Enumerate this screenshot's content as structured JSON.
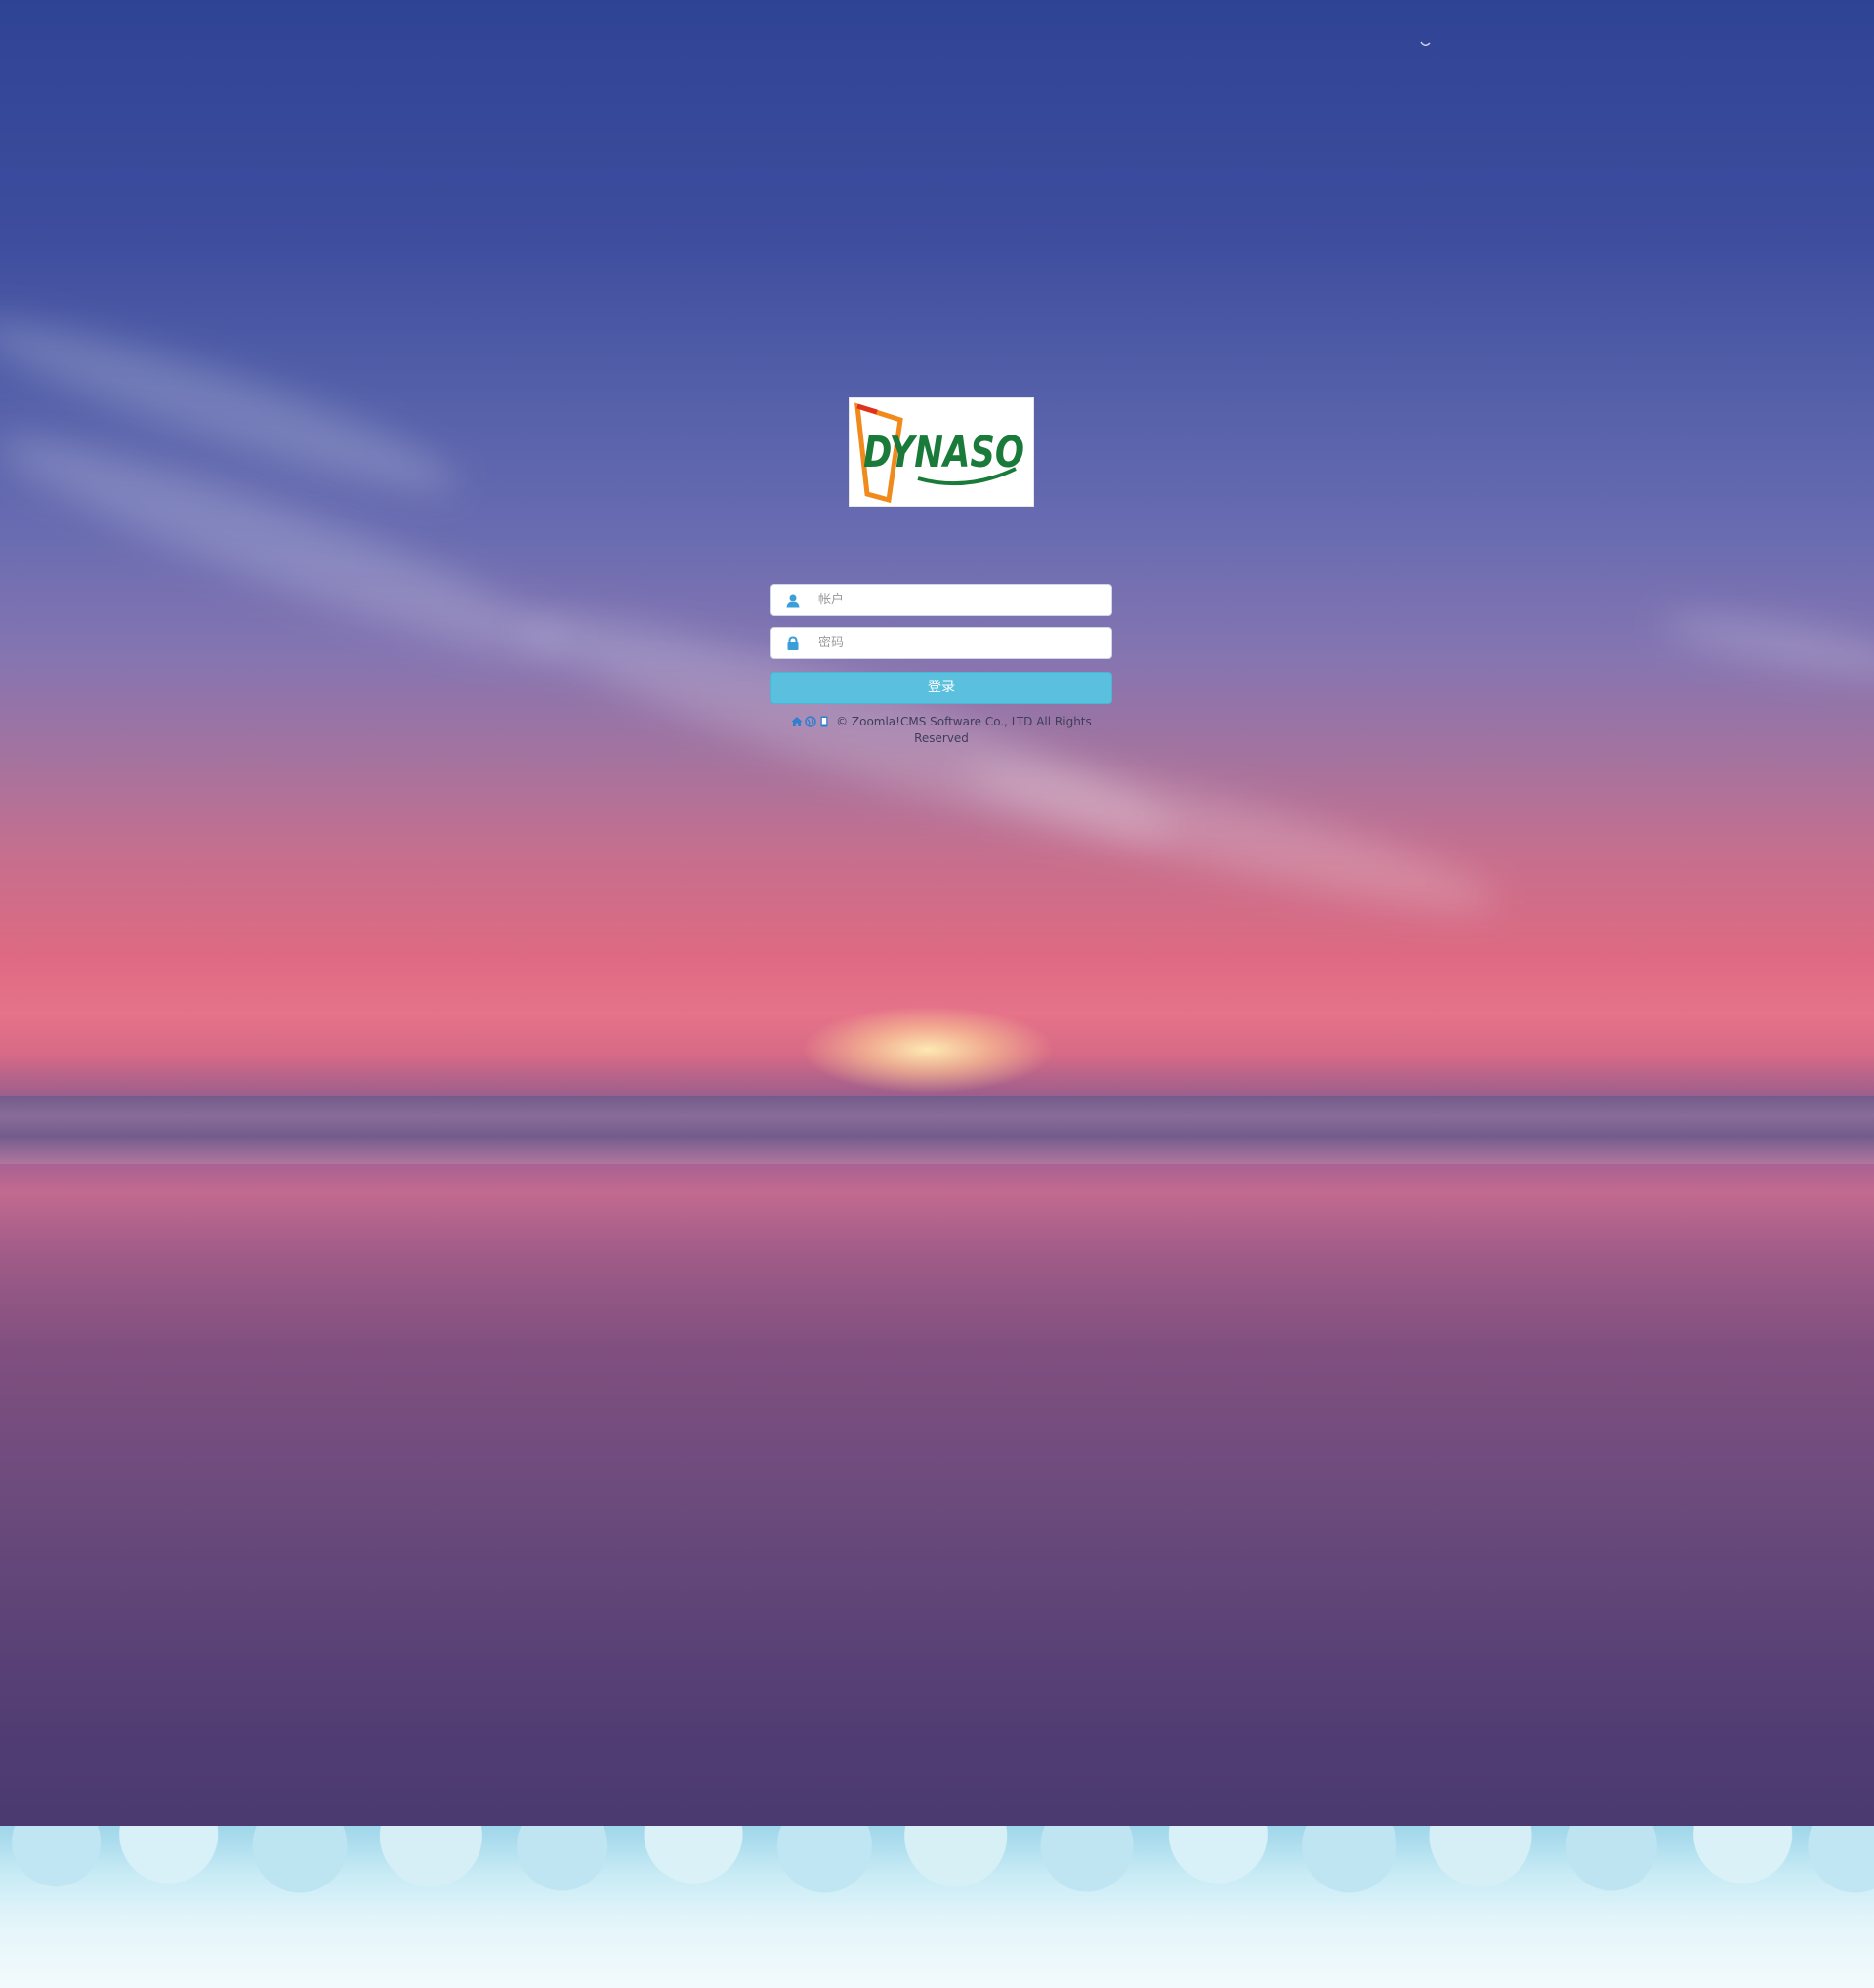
{
  "login": {
    "username_placeholder": "帐户",
    "password_placeholder": "密码",
    "submit_label": "登录"
  },
  "logo": {
    "text": "DYNASO",
    "icon": "dynaso-logo"
  },
  "footer": {
    "icons": [
      "home-icon",
      "globe-icon",
      "phone-icon"
    ],
    "copyright": "© Zoomla!CMS Software Co., LTD All Rights Reserved"
  },
  "colors": {
    "button": "#5bc0de",
    "icon_blue": "#3a9fd6",
    "logo_green": "#1a7a3a",
    "logo_orange": "#f08a1c",
    "logo_red": "#e0301e"
  }
}
